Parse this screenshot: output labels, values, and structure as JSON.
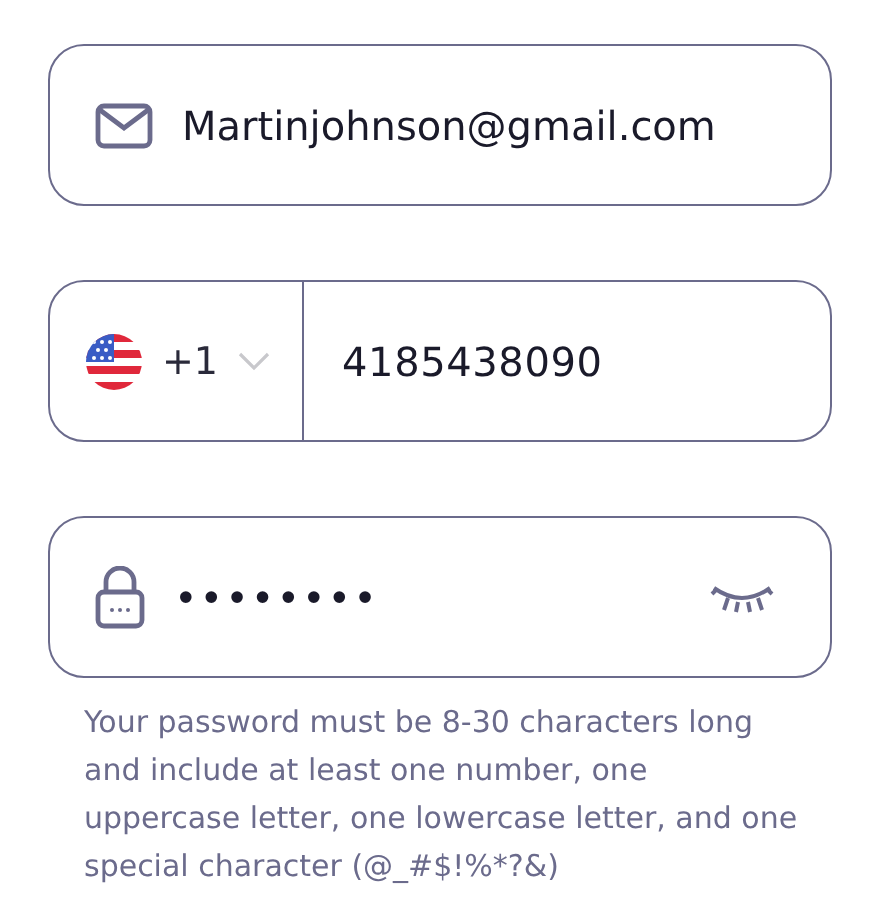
{
  "email": {
    "value": "Martinjohnson@gmail.com"
  },
  "phone": {
    "country_code": "+1",
    "value": "4185438090"
  },
  "password": {
    "value": "••••••••",
    "hint": "Your password must be 8-30 characters long and include at least one number, one uppercase letter, one lowercase letter, and one special character (@_#$!%*?&)"
  }
}
